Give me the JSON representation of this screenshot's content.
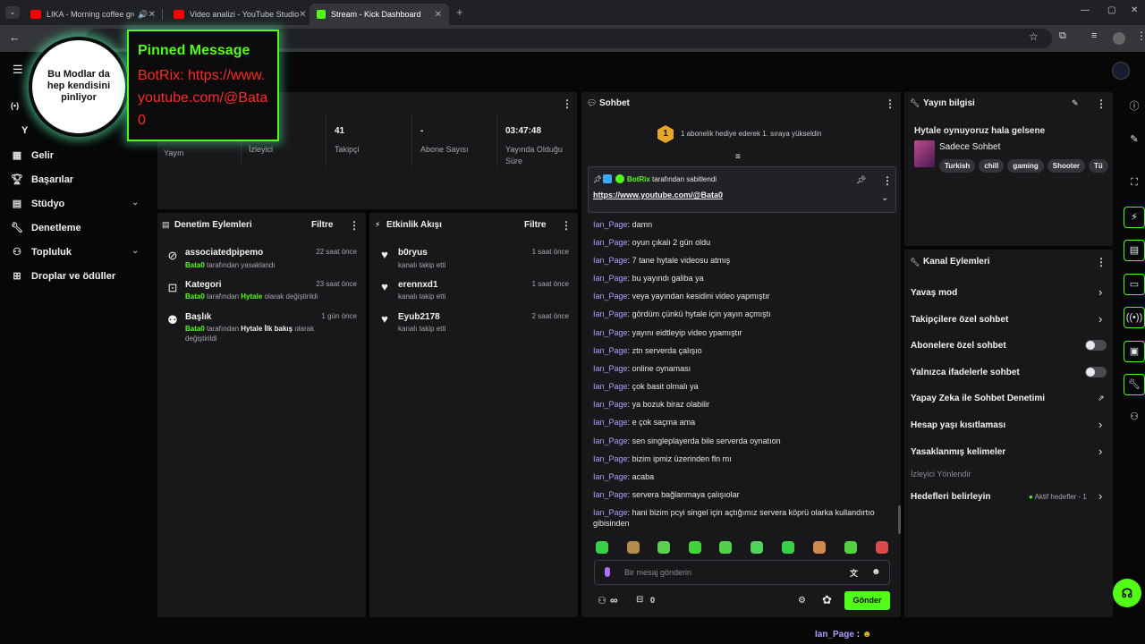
{
  "browser": {
    "tabs": [
      {
        "title": "LIKA - Morning coffee groo",
        "active": false
      },
      {
        "title": "Video analizi - YouTube Studio",
        "active": false
      },
      {
        "title": "Stream - Kick Dashboard",
        "active": true
      }
    ]
  },
  "overlay": {
    "circle_text": "Bu Modlar da hep kendisini pinliyor",
    "pinned_title": "Pinned Message",
    "pinned_body": "BotRix: https://www.youtube.com/@Bata0"
  },
  "sidebar": {
    "items": [
      {
        "label": "Gelir",
        "icon": "dollar-icon"
      },
      {
        "label": "Başarılar",
        "icon": "trophy-icon"
      },
      {
        "label": "Stüdyo",
        "icon": "studio-icon",
        "expandable": true
      },
      {
        "label": "Denetleme",
        "icon": "wrench-icon"
      },
      {
        "label": "Topluluk",
        "icon": "community-icon",
        "expandable": true
      },
      {
        "label": "Droplar ve ödüller",
        "icon": "drops-icon"
      }
    ]
  },
  "stats": [
    {
      "value": "",
      "label": "Yayın"
    },
    {
      "value": "",
      "label": "İzleyici"
    },
    {
      "value": "41",
      "label": "Takipçi"
    },
    {
      "value": "-",
      "label": "Abone Sayısı"
    },
    {
      "value": "03:47:48",
      "label": "Yayında Olduğu Süre"
    }
  ],
  "moderation": {
    "title": "Denetim Eylemleri",
    "filter": "Filtre",
    "items": [
      {
        "title": "associatedpipemo",
        "actor": "Bata0",
        "text": " tarafından yasaklandı",
        "time": "22 saat önce",
        "icon": "ban-icon"
      },
      {
        "title": "Kategori",
        "actor": "Bata0",
        "text": " tarafından ",
        "value": "Hytale",
        "text2": " olarak değiştirildi",
        "time": "23 saat önce",
        "icon": "category-icon"
      },
      {
        "title": "Başlık",
        "actor": "Bata0",
        "text": " tarafından ",
        "value": "Hytale İlk bakış",
        "text2": " olarak değiştirildi",
        "time": "1 gün önce",
        "icon": "title-change-icon"
      }
    ]
  },
  "activity": {
    "title": "Etkinlik Akışı",
    "filter": "Filtre",
    "items": [
      {
        "user": "b0ryus",
        "text": "kanalı takip etti",
        "time": "1 saat önce"
      },
      {
        "user": "erennxd1",
        "text": "kanalı takip etti",
        "time": "1 saat önce"
      },
      {
        "user": "Eyub2178",
        "text": "kanalı takip etti",
        "time": "2 saat önce"
      }
    ]
  },
  "chat": {
    "title": "Sohbet",
    "gift_banner": {
      "badge": "1",
      "text": "1 abonelik hediye ederek 1. sıraya yükseldin"
    },
    "pinned": {
      "by": "BotRix",
      "by_suffix": " tarafından sabitlendi",
      "link": "https://www.youtube.com/@Bata0"
    },
    "messages": [
      {
        "user": "Ian_Page",
        "text": "damn"
      },
      {
        "user": "Ian_Page",
        "text": "oyun çıkalı 2 gün oldu"
      },
      {
        "user": "Ian_Page",
        "text": "7 tane hytale videosu atmış"
      },
      {
        "user": "Ian_Page",
        "text": "bu yayındı galiba ya"
      },
      {
        "user": "Ian_Page",
        "text": "veya yayından kesidini video yapmıştır"
      },
      {
        "user": "Ian_Page",
        "text": "gördüm çünkü hytale için yayın açmıştı"
      },
      {
        "user": "Ian_Page",
        "text": "yayını eidtleyip video ypamıştır"
      },
      {
        "user": "Ian_Page",
        "text": "ztn serverda çalışıo"
      },
      {
        "user": "Ian_Page",
        "text": "online oynaması"
      },
      {
        "user": "Ian_Page",
        "text": "çok basit olmalı ya"
      },
      {
        "user": "Ian_Page",
        "text": "ya bozuk biraz olabilir"
      },
      {
        "user": "Ian_Page",
        "text": "e çok saçma ama"
      },
      {
        "user": "Ian_Page",
        "text": "sen singleplayerda bile serverda oynatıon"
      },
      {
        "user": "Ian_Page",
        "text": "bizim ipmiz üzerinden fln mı"
      },
      {
        "user": "Ian_Page",
        "text": "acaba"
      },
      {
        "user": "Ian_Page",
        "text": "servera bağlanmaya çalışıolar"
      },
      {
        "user": "Ian_Page",
        "text": "hani bizim pcyi singel için açtığımız servera köprü olarka kullandırtıo gibisinden"
      }
    ],
    "input_placeholder": "Bir mesaj gönderin",
    "points": "∞",
    "gift_count": "0",
    "send_label": "Gönder"
  },
  "stream_info": {
    "title": "Yayın bilgisi",
    "stream_title": "Hytale oynuyoruz hala gelsene",
    "category": "Sadece Sohbet",
    "tags": [
      "Turkish",
      "chill",
      "gaming",
      "Shooter",
      "Tü"
    ]
  },
  "channel_actions": {
    "title": "Kanal Eylemleri",
    "rows": [
      {
        "label": "Yavaş mod",
        "control": "chevron"
      },
      {
        "label": "Takipçilere özel sohbet",
        "control": "chevron"
      },
      {
        "label": "Abonelere özel sohbet",
        "control": "toggle"
      },
      {
        "label": "Yalnızca ifadelerle sohbet",
        "control": "toggle"
      },
      {
        "label": "Yapay Zeka ile Sohbet Denetimi",
        "control": "external"
      },
      {
        "label": "Hesap yaşı kısıtlaması",
        "control": "chevron"
      },
      {
        "label": "Yasaklanmış kelimeler",
        "control": "chevron"
      }
    ],
    "section_label": "İzleyici Yönlendir",
    "goals_label": "Hedefleri belirleyin",
    "goals_status": "Aktif hedefler - 1"
  },
  "bottom_caption": {
    "user": "Ian_Page",
    "text": " : "
  },
  "colors": {
    "accent": "#53fc18",
    "username": "#b49cff",
    "panel": "#18181b"
  }
}
